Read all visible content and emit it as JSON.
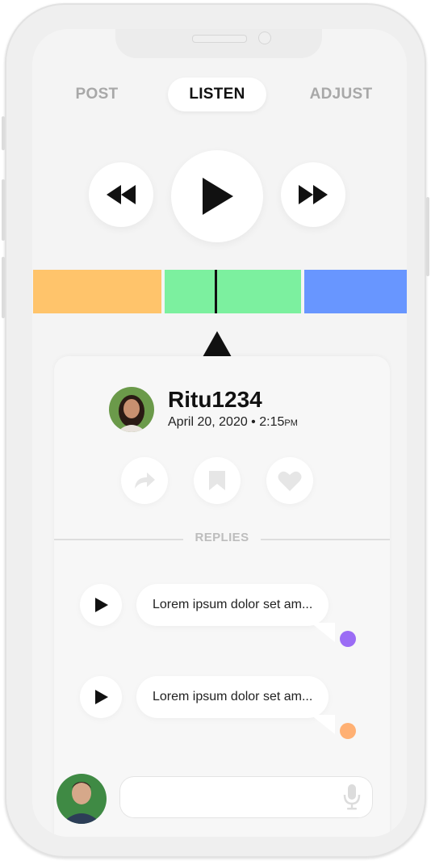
{
  "tabs": [
    {
      "label": "POST",
      "active": false
    },
    {
      "label": "LISTEN",
      "active": true
    },
    {
      "label": "ADJUST",
      "active": false
    }
  ],
  "player": {
    "controls": [
      "rewind-icon",
      "play-icon",
      "fast-forward-icon"
    ]
  },
  "timeline": {
    "segments": [
      {
        "color": "#FFC46B"
      },
      {
        "color": "#7CF09F"
      },
      {
        "color": "#6896FF"
      }
    ],
    "active_segment": 1
  },
  "post": {
    "username": "Ritu1234",
    "date": "April 20, 2020 • 2:15",
    "ampm": "PM",
    "actions": [
      "share-icon",
      "bookmark-icon",
      "heart-icon"
    ]
  },
  "replies": {
    "label": "REPLIES",
    "items": [
      {
        "text": "Lorem ipsum dolor set am...",
        "dot_color": "#9B6CF5"
      },
      {
        "text": "Lorem ipsum dolor set am...",
        "dot_color": "#FFB073"
      }
    ]
  },
  "composer": {
    "mic_icon": "microphone-icon"
  }
}
